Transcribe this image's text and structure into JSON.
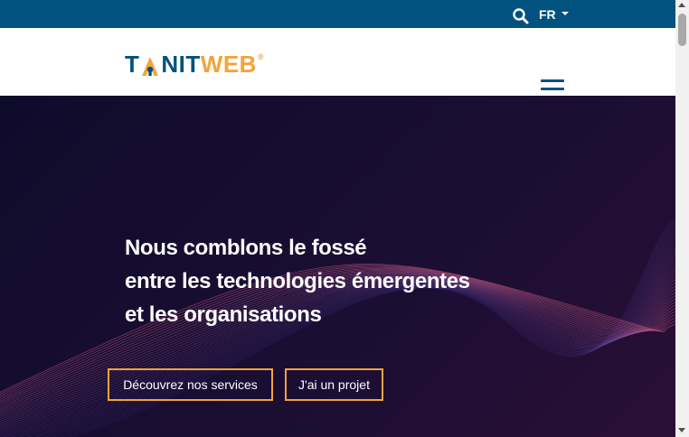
{
  "topbar": {
    "search_icon": "search-icon",
    "language": "FR",
    "background": "#01527f"
  },
  "navbar": {
    "logo": {
      "part1": "T",
      "part_mark": "A",
      "part2": "NIT",
      "part3": "WEB",
      "registered": "®"
    },
    "menu_icon": "hamburger-menu-icon"
  },
  "hero": {
    "title_lines": [
      "Nous comblons le fossé",
      "entre les technologies émergentes",
      "et les organisations"
    ],
    "buttons": {
      "services": "Découvrez nos services",
      "project": "J'ai un projet"
    }
  },
  "colors": {
    "brand_blue": "#01527f",
    "accent_orange": "#f5a33a",
    "hero_bg": "#140d2e"
  }
}
